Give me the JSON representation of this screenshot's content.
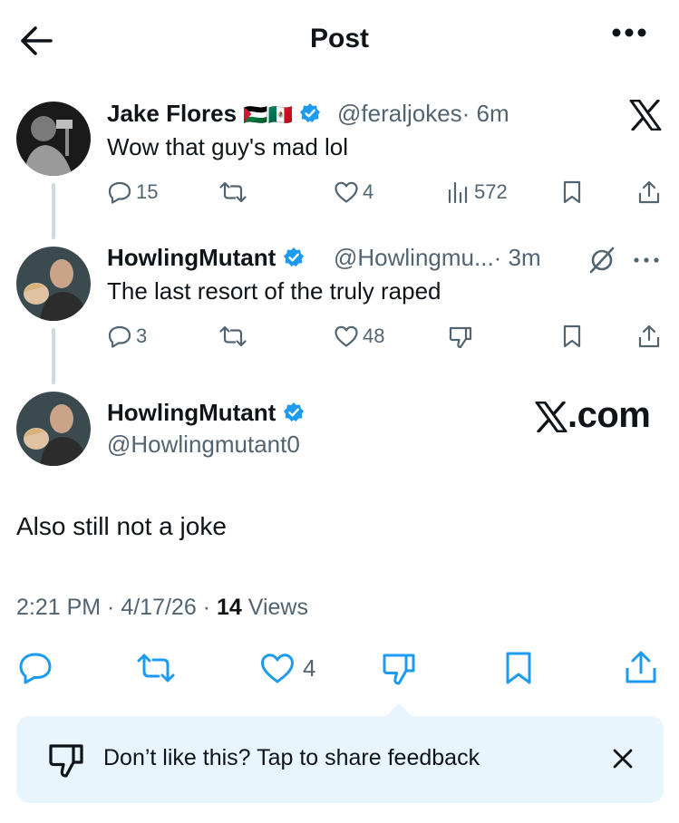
{
  "header": {
    "title": "Post"
  },
  "tweets": [
    {
      "name": "Jake Flores",
      "flags": "🇵🇸🇲🇽",
      "handle": "@feraljokes",
      "time": "· 6m",
      "text": "Wow that guy's mad lol",
      "replies": "15",
      "likes": "4",
      "views": "572"
    },
    {
      "name": "HowlingMutant",
      "handle": "@Howlingmu...",
      "time": "· 3m",
      "text": "The last resort of the truly raped",
      "replies": "3",
      "likes": "48"
    }
  ],
  "main_post": {
    "name": "HowlingMutant",
    "handle": "@Howlingmutant0",
    "text": "Also still not a joke",
    "timestamp": "2:21 PM · 4/17/26 ·",
    "views_count": "14",
    "views_label": "Views",
    "likes": "4"
  },
  "watermark": {
    "text": ".com"
  },
  "feedback": {
    "text": "Don’t like this? Tap to share feedback"
  },
  "colors": {
    "verified": "#1d9bf0",
    "muted": "#536471",
    "feedback_bg": "#e8f5fd"
  }
}
